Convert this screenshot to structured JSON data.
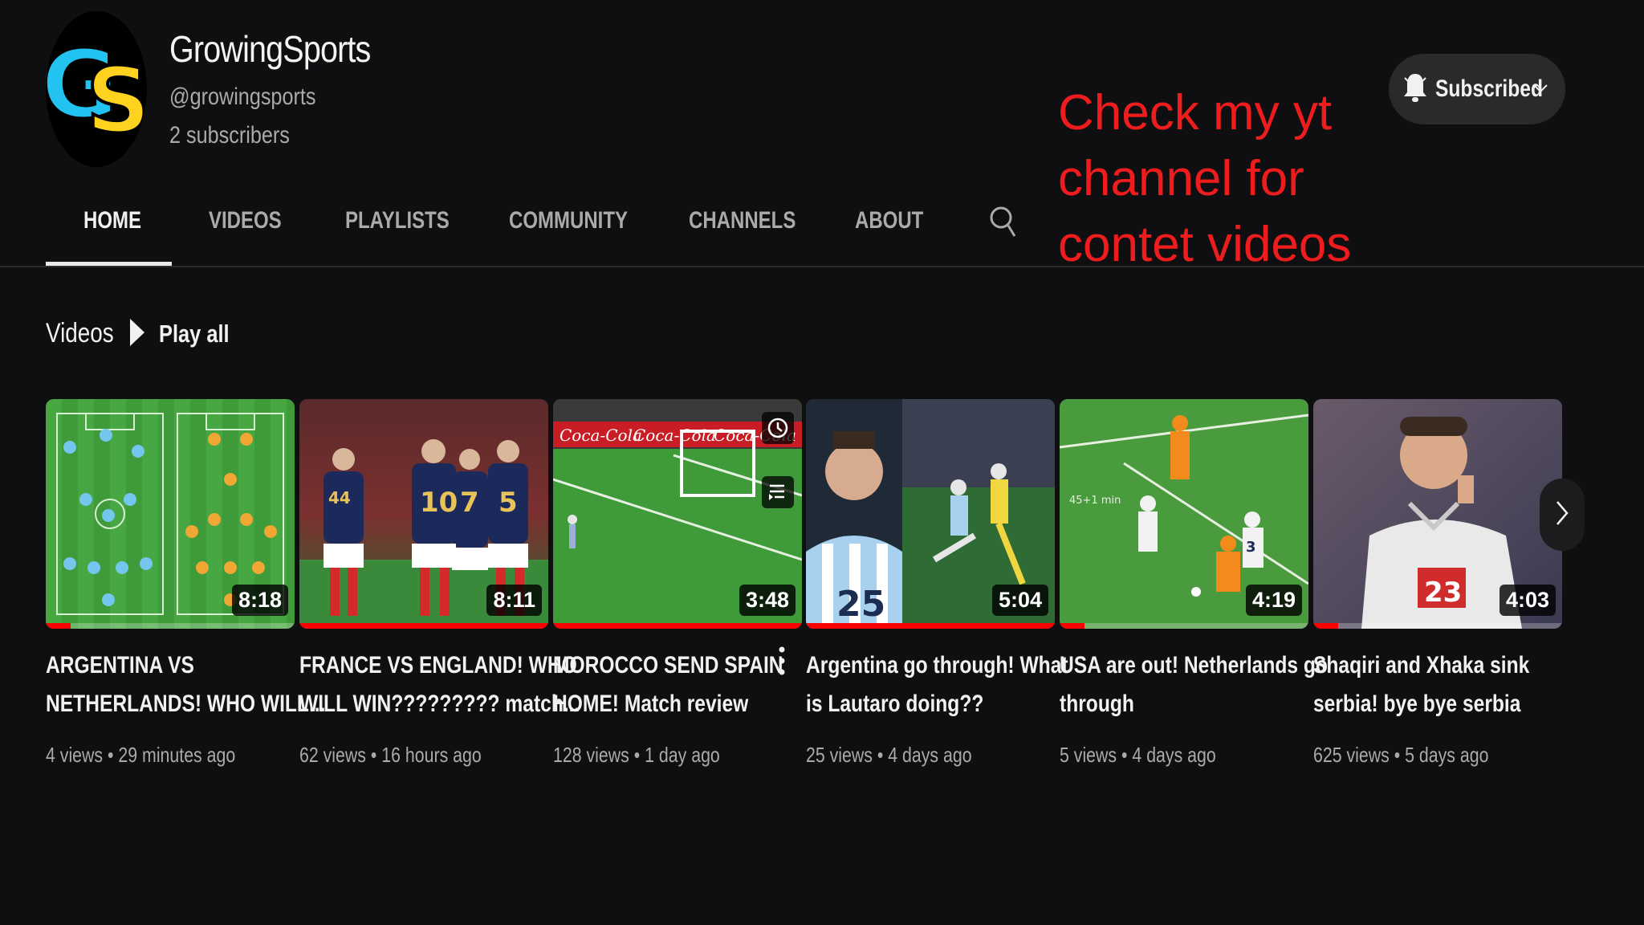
{
  "channel": {
    "name": "GrowingSports",
    "handle": "@growingsports",
    "subscribers": "2 subscribers",
    "logo_text": "GS",
    "logo_colors": {
      "g": "#22c3f0",
      "s": "#ffd21f",
      "bg": "#000000"
    }
  },
  "subscribe_button": {
    "label": "Subscribed",
    "icon": "bell-icon",
    "dropdown_icon": "chevron-down-icon"
  },
  "promo_text": [
    "Check my yt",
    "channel for",
    "contet videos"
  ],
  "tabs": [
    {
      "label": "HOME",
      "active": true
    },
    {
      "label": "VIDEOS",
      "active": false
    },
    {
      "label": "PLAYLISTS",
      "active": false
    },
    {
      "label": "COMMUNITY",
      "active": false
    },
    {
      "label": "CHANNELS",
      "active": false
    },
    {
      "label": "ABOUT",
      "active": false
    }
  ],
  "section": {
    "title": "Videos",
    "play_all": "Play all"
  },
  "videos": [
    {
      "title_lines": [
        "ARGENTINA VS",
        "NETHERLANDS! WHO WILL..."
      ],
      "duration": "8:18",
      "views": "4 views",
      "age": "29 minutes ago",
      "progress": 0.1
    },
    {
      "title_lines": [
        "FRANCE VS ENGLAND! WHO",
        "WILL WIN????????? match..."
      ],
      "duration": "8:11",
      "views": "62 views",
      "age": "16 hours ago",
      "progress": 1.0
    },
    {
      "title_lines": [
        "MOROCCO SEND SPAIN",
        "HOME! Match review"
      ],
      "duration": "3:48",
      "views": "128 views",
      "age": "1 day ago",
      "progress": 1.0
    },
    {
      "title_lines": [
        "Argentina go through! What",
        "is Lautaro doing??"
      ],
      "duration": "5:04",
      "views": "25 views",
      "age": "4 days ago",
      "progress": 1.0
    },
    {
      "title_lines": [
        "USA are out! Netherlands go",
        "through"
      ],
      "duration": "4:19",
      "views": "5 views",
      "age": "4 days ago",
      "progress": 0.1
    },
    {
      "title_lines": [
        "Shaqiri and Xhaka sink",
        "serbia! bye bye serbia"
      ],
      "duration": "4:03",
      "views": "625 views",
      "age": "5 days ago",
      "progress": 0.1
    }
  ],
  "thumb_text": {
    "ad_brand": "Coca-Cola",
    "overlay_text": "45+1 min",
    "jersey_numbers": [
      "10",
      "7",
      "5",
      "44",
      "25",
      "3",
      "23"
    ]
  },
  "colors": {
    "background": "#0f0f12",
    "accent": "#ff0000",
    "promo": "#ee1c1c",
    "muted": "#aaaaaa"
  }
}
